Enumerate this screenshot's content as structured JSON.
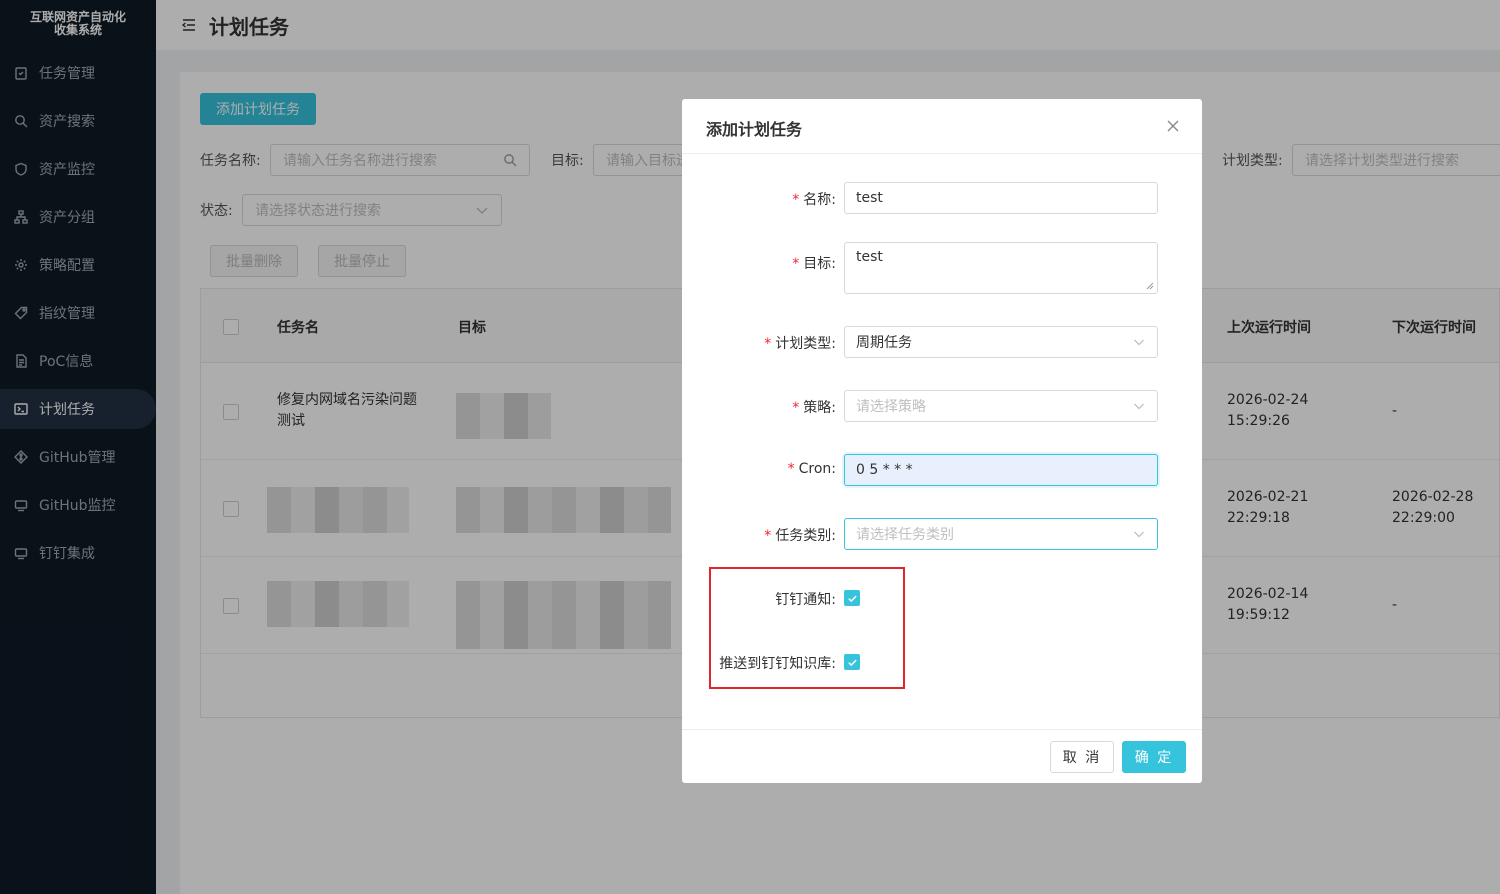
{
  "app": {
    "logo_line1": "互联网资产自动化",
    "logo_line2": "收集系统"
  },
  "sidebar": {
    "items": [
      {
        "label": "任务管理",
        "icon": "clipboard-icon"
      },
      {
        "label": "资产搜索",
        "icon": "search-icon"
      },
      {
        "label": "资产监控",
        "icon": "shield-icon"
      },
      {
        "label": "资产分组",
        "icon": "sitemap-icon"
      },
      {
        "label": "策略配置",
        "icon": "gear-icon"
      },
      {
        "label": "指纹管理",
        "icon": "tag-icon"
      },
      {
        "label": "PoC信息",
        "icon": "document-icon"
      },
      {
        "label": "计划任务",
        "icon": "terminal-icon",
        "active": true
      },
      {
        "label": "GitHub管理",
        "icon": "git-icon"
      },
      {
        "label": "GitHub监控",
        "icon": "monitor-icon"
      },
      {
        "label": "钉钉集成",
        "icon": "monitor-icon"
      }
    ]
  },
  "header": {
    "title": "计划任务"
  },
  "toolbar": {
    "add_label": "添加计划任务",
    "batch_delete": "批量删除",
    "batch_stop": "批量停止"
  },
  "filters": {
    "task_name_label": "任务名称:",
    "task_name_placeholder": "请输入任务名称进行搜索",
    "target_label": "目标:",
    "target_placeholder": "请输入目标进",
    "plan_type_label": "计划类型:",
    "plan_type_placeholder": "请选择计划类型进行搜索",
    "status_label": "状态:",
    "status_placeholder": "请选择状态进行搜索"
  },
  "table": {
    "columns": {
      "name": "任务名",
      "target": "目标",
      "last_run": "上次运行时间",
      "next_run": "下次运行时间"
    },
    "rows": [
      {
        "name_line1": "修复内网域名污染问题",
        "name_line2": "测试",
        "last_run_date": "2026-02-24",
        "last_run_time": "15:29:26",
        "next_run_date": "-",
        "next_run_time": ""
      },
      {
        "name_line1": "",
        "name_line2": "",
        "last_run_date": "2026-02-21",
        "last_run_time": "22:29:18",
        "next_run_date": "2026-02-28",
        "next_run_time": "22:29:00"
      },
      {
        "name_line1": "",
        "name_line2": "",
        "last_run_date": "2026-02-14",
        "last_run_time": "19:59:12",
        "next_run_date": "-",
        "next_run_time": ""
      }
    ]
  },
  "modal": {
    "title": "添加计划任务",
    "fields": {
      "name_label": "名称",
      "name_value": "test",
      "target_label": "目标",
      "target_value": "test",
      "plan_type_label": "计划类型",
      "plan_type_value": "周期任务",
      "strategy_label": "策略",
      "strategy_placeholder": "请选择策略",
      "cron_label": "Cron",
      "cron_value": "0 5 * * *",
      "category_label": "任务类别",
      "category_placeholder": "请选择任务类别",
      "dingtalk_notify_label": "钉钉通知:",
      "dingtalk_kb_label": "推送到钉钉知识库:"
    },
    "cancel_label": "取 消",
    "ok_label": "确 定"
  },
  "colors": {
    "accent": "#36c3dc",
    "sidebar_bg": "#0e1a26",
    "required": "#f5222d",
    "highlight_box": "#e0262b"
  }
}
